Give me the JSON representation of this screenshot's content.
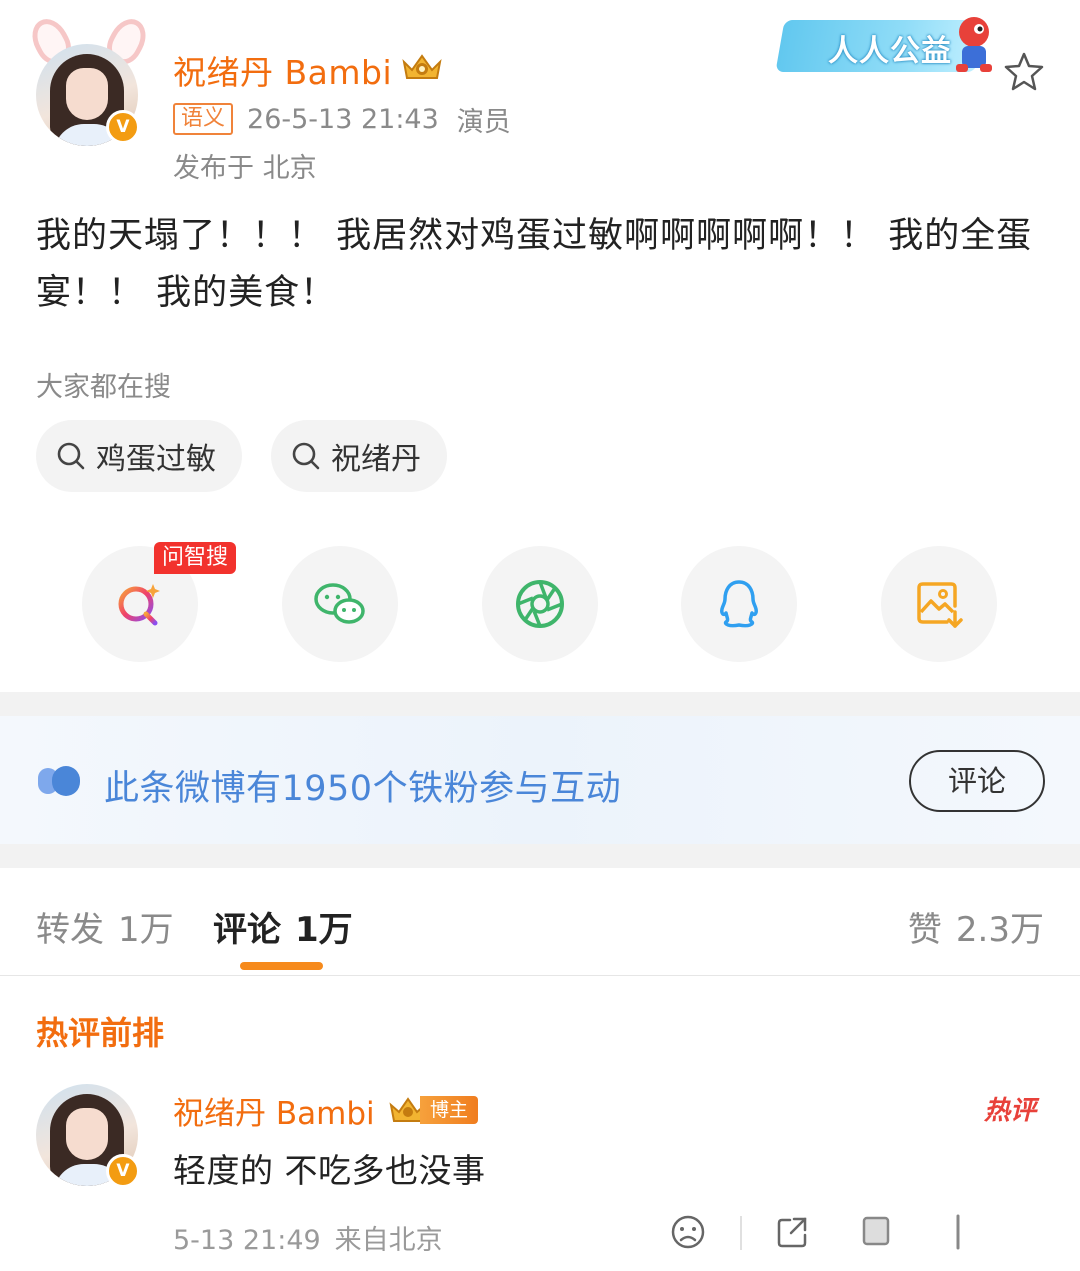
{
  "post": {
    "user_name": "祝绪丹 Bambi",
    "tag": "语义",
    "time": "26-5-13 21:43",
    "role": "演员",
    "location": "发布于 北京",
    "content": "我的天塌了！！！ 我居然对鸡蛋过敏啊啊啊啊啊！！ 我的全蛋宴！！ 我的美食！",
    "charity_text": "人人公益"
  },
  "search": {
    "title": "大家都在搜",
    "chips": [
      "鸡蛋过敏",
      "祝绪丹"
    ]
  },
  "share": {
    "badge": "问智搜",
    "items": [
      "wenzhisou-icon",
      "wechat-icon",
      "moments-icon",
      "qq-icon",
      "save-image-icon"
    ]
  },
  "fans_banner": {
    "text": "此条微博有1950个铁粉参与互动",
    "button": "评论"
  },
  "tabs": {
    "repost_label": "转发",
    "repost_count": "1万",
    "comment_label": "评论",
    "comment_count": "1万",
    "like_label": "赞",
    "like_count": "2.3万"
  },
  "hot": {
    "title": "热评前排"
  },
  "comment": {
    "user_name": "祝绪丹 Bambi",
    "role_badge": "博主",
    "hot_badge": "热评",
    "text": "轻度的 不吃多也没事",
    "time": "5-13 21:49",
    "location": "来自北京"
  },
  "colors": {
    "accent_orange": "#f26d0f",
    "link_blue": "#4a86d8",
    "hot_red": "#e8413a"
  }
}
